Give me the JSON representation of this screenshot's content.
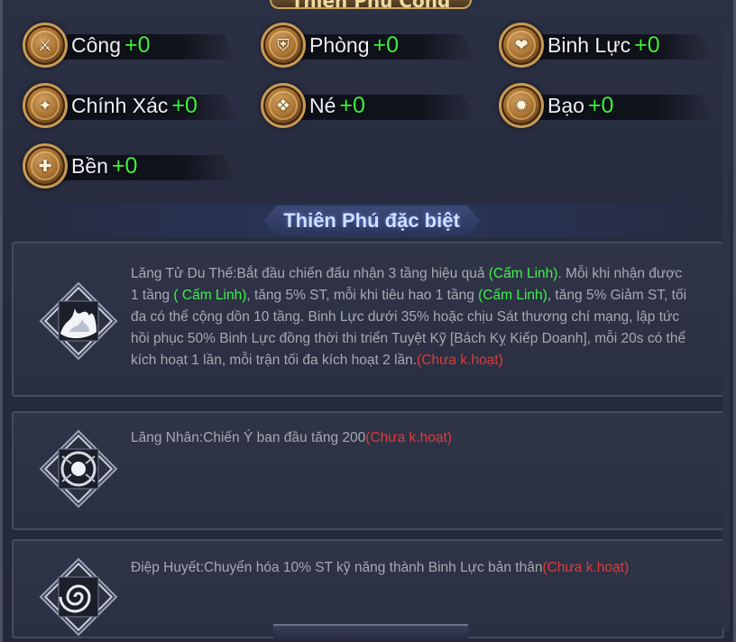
{
  "header": {
    "banner_text": "Thiên Phú Công"
  },
  "stats": [
    {
      "label": "Công",
      "value": "+0",
      "icon": "sword-icon",
      "glyph": "⚔"
    },
    {
      "label": "Phòng",
      "value": "+0",
      "icon": "shield-icon",
      "glyph": "⛨"
    },
    {
      "label": "Binh Lực",
      "value": "+0",
      "icon": "heart-icon",
      "glyph": "❤"
    },
    {
      "label": "Chính Xác",
      "value": "+0",
      "icon": "target-icon",
      "glyph": "✦"
    },
    {
      "label": "Né",
      "value": "+0",
      "icon": "dodge-icon",
      "glyph": "❖"
    },
    {
      "label": "Bạo",
      "value": "+0",
      "icon": "crit-icon",
      "glyph": "✹"
    },
    {
      "label": "Bền",
      "value": "+0",
      "icon": "armor-icon",
      "glyph": "✚"
    }
  ],
  "section": {
    "title": "Thiên Phú đặc biệt"
  },
  "talents": [
    {
      "icon": "flame-burst-icon",
      "name": "Lăng Tử Du Thế:",
      "parts": [
        {
          "text": "Bắt đầu chiến đấu nhận 3 tầng hiệu quả ",
          "style": "normal"
        },
        {
          "text": "(Cấm Linh)",
          "style": "green"
        },
        {
          "text": ". Mỗi khi nhận được 1 tầng ",
          "style": "normal"
        },
        {
          "text": "( Cấm Linh)",
          "style": "green"
        },
        {
          "text": ", tăng 5% ST, mỗi khi tiêu hao 1 tầng ",
          "style": "normal"
        },
        {
          "text": "(Cấm Linh)",
          "style": "green"
        },
        {
          "text": ", tăng 5% Giảm ST, tối đa có thể cộng dồn 10 tầng. Binh Lực dưới 35% hoặc chịu Sát thương chí mạng, lập tức hồi phục 50% Binh Lực đồng thời thi triển Tuyệt Kỹ [Bách Kỵ Kiếp Doanh], mỗi 20s có thể kích hoạt 1 lần, mỗi trận tối đa kích hoạt 2 lần.",
          "style": "normal"
        },
        {
          "text": "(Chưa k.hoạt)",
          "style": "red"
        }
      ]
    },
    {
      "icon": "spirit-orb-icon",
      "name": "Lăng Nhân:",
      "parts": [
        {
          "text": "Chiến Ý ban đầu tăng 200",
          "style": "normal"
        },
        {
          "text": "(Chưa k.hoạt)",
          "style": "red"
        }
      ]
    },
    {
      "icon": "vortex-icon",
      "name": "Điệp Huyết:",
      "parts": [
        {
          "text": "Chuyển hóa 10% ST kỹ năng thành Binh Lực bản thân",
          "style": "normal"
        },
        {
          "text": "(Chưa k.hoạt)",
          "style": "red"
        }
      ]
    }
  ],
  "colors": {
    "stat_value": "#3df23d",
    "highlight": "#3ff04a",
    "inactive": "#e03a3a"
  }
}
